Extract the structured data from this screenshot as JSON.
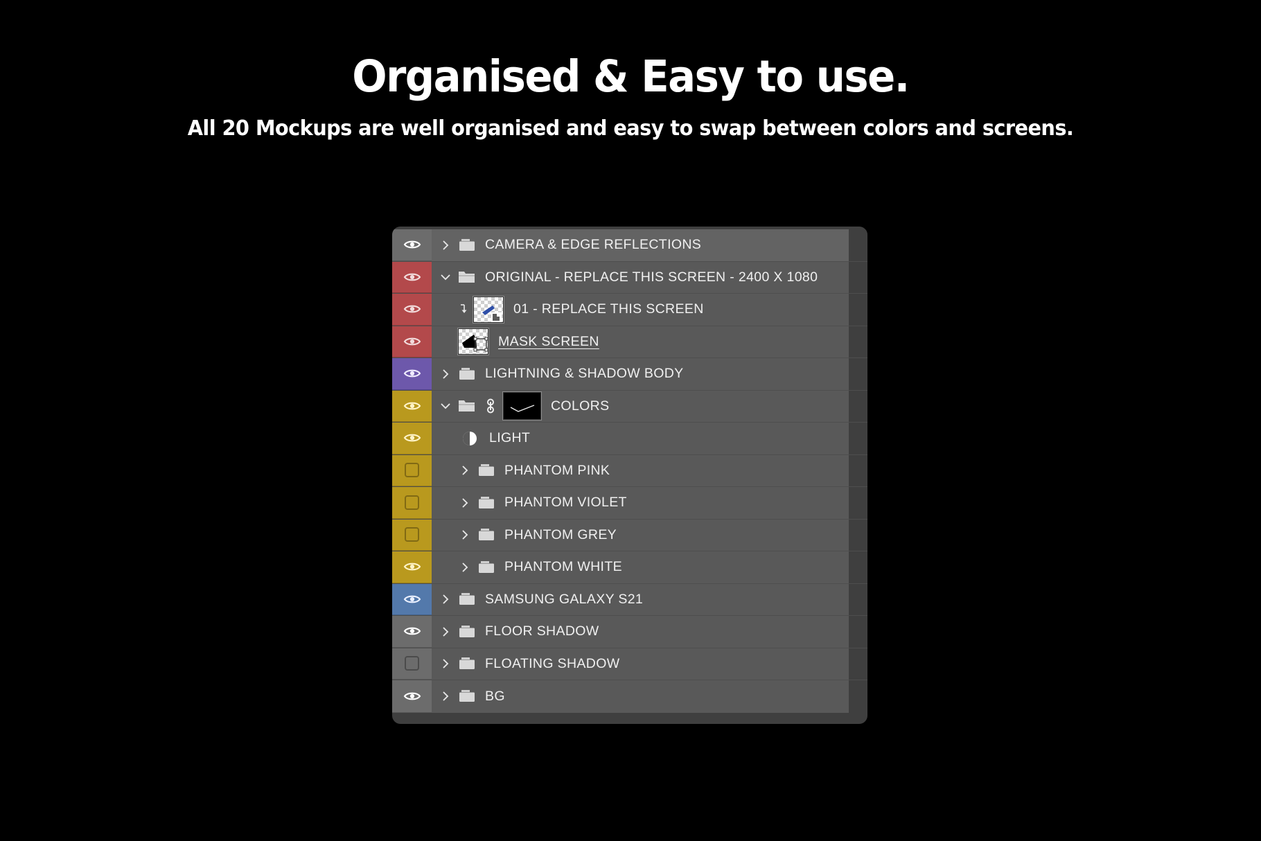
{
  "header": {
    "headline": "Organised & Easy to use.",
    "subhead": "All 20 Mockups are well organised and easy to swap between colors and screens."
  },
  "colors": {
    "background": "#000000",
    "panel_bg": "#3f3f3f",
    "row_bg": "#595959",
    "row_bg_first": "#636363",
    "chip_red": "#b3494b",
    "chip_violet": "#6d58ab",
    "chip_yellow": "#b9991e",
    "chip_blue": "#5379ab",
    "chip_grey": "#6c6c6c",
    "text": "#f0f0f0"
  },
  "layers_panel": {
    "rows": [
      {
        "label": "CAMERA & EDGE REFLECTIONS",
        "chip": "grey",
        "visible": true,
        "expanded": false,
        "has_chevron": true,
        "icon": "folder-closed-icon",
        "indent": 1,
        "underline": false,
        "first": true
      },
      {
        "label": "ORIGINAL - REPLACE THIS SCREEN - 2400 X 1080",
        "chip": "red",
        "visible": true,
        "expanded": true,
        "has_chevron": true,
        "icon": "folder-open-icon",
        "indent": 1,
        "underline": false
      },
      {
        "label": "01 - REPLACE THIS SCREEN",
        "chip": "red",
        "visible": true,
        "expanded": false,
        "has_chevron": false,
        "icon": "smart-object-thumbnail",
        "clipped": true,
        "indent": 2,
        "underline": false
      },
      {
        "label": "MASK SCREEN",
        "chip": "red",
        "visible": true,
        "expanded": false,
        "has_chevron": false,
        "icon": "shape-thumbnail",
        "indent": 2,
        "underline": true
      },
      {
        "label": "LIGHTNING & SHADOW BODY",
        "chip": "violet",
        "visible": true,
        "expanded": false,
        "has_chevron": true,
        "icon": "folder-closed-icon",
        "indent": 1,
        "underline": false
      },
      {
        "label": "COLORS",
        "chip": "yellow",
        "visible": true,
        "expanded": true,
        "has_chevron": true,
        "icon": "folder-open-icon",
        "link": true,
        "curve_thumb": true,
        "indent": 1,
        "underline": false
      },
      {
        "label": "LIGHT",
        "chip": "yellow",
        "visible": true,
        "expanded": false,
        "has_chevron": false,
        "icon": "adjustment-half-circle-icon",
        "indent": 3,
        "underline": false
      },
      {
        "label": "PHANTOM PINK",
        "chip": "yellow",
        "visible": false,
        "expanded": false,
        "has_chevron": true,
        "icon": "folder-closed-icon",
        "indent": 2,
        "underline": false
      },
      {
        "label": "PHANTOM VIOLET",
        "chip": "yellow",
        "visible": false,
        "expanded": false,
        "has_chevron": true,
        "icon": "folder-closed-icon",
        "indent": 2,
        "underline": false
      },
      {
        "label": "PHANTOM GREY",
        "chip": "yellow",
        "visible": false,
        "expanded": false,
        "has_chevron": true,
        "icon": "folder-closed-icon",
        "indent": 2,
        "underline": false
      },
      {
        "label": "PHANTOM WHITE",
        "chip": "yellow",
        "visible": true,
        "expanded": false,
        "has_chevron": true,
        "icon": "folder-closed-icon",
        "indent": 2,
        "underline": false
      },
      {
        "label": "SAMSUNG GALAXY S21",
        "chip": "blue",
        "visible": true,
        "expanded": false,
        "has_chevron": true,
        "icon": "folder-closed-icon",
        "indent": 1,
        "underline": false
      },
      {
        "label": "FLOOR SHADOW",
        "chip": "grey",
        "visible": true,
        "expanded": false,
        "has_chevron": true,
        "icon": "folder-closed-icon",
        "indent": 1,
        "underline": false
      },
      {
        "label": "FLOATING SHADOW",
        "chip": "grey",
        "visible": false,
        "expanded": false,
        "has_chevron": true,
        "icon": "folder-closed-icon",
        "indent": 1,
        "underline": false
      },
      {
        "label": "BG",
        "chip": "grey",
        "visible": true,
        "expanded": false,
        "has_chevron": true,
        "icon": "folder-closed-icon",
        "indent": 1,
        "underline": false
      }
    ]
  }
}
